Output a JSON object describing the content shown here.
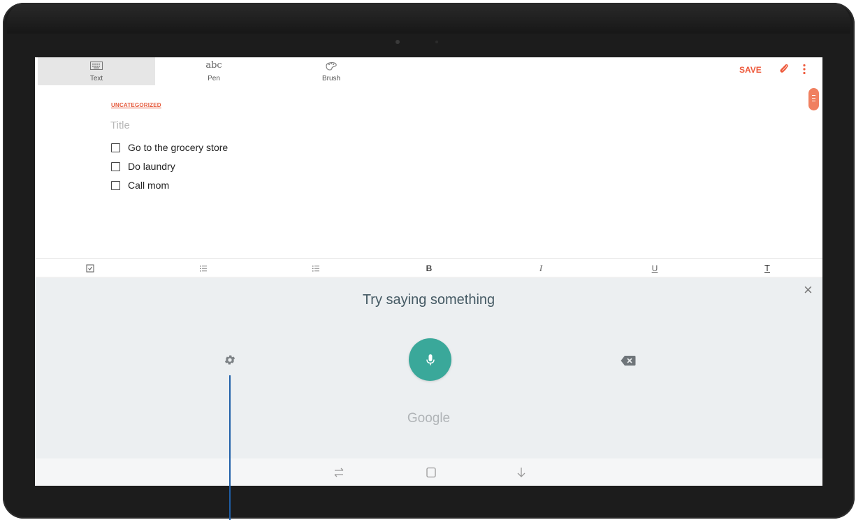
{
  "toolbar": {
    "modes": [
      {
        "label": "Text",
        "glyph": "",
        "icon": "keyboard-icon",
        "active": true
      },
      {
        "label": "Pen",
        "glyph": "abc",
        "icon": "pen-icon",
        "active": false
      },
      {
        "label": "Brush",
        "glyph": "",
        "icon": "brush-icon",
        "active": false
      }
    ],
    "save_label": "SAVE",
    "accent_color": "#ee5a3c"
  },
  "note": {
    "category": "UNCATEGORIZED",
    "title_placeholder": "Title",
    "checklist": [
      {
        "text": "Go to the grocery store",
        "checked": false
      },
      {
        "text": "Do laundry",
        "checked": false
      },
      {
        "text": "Call mom",
        "checked": false
      }
    ]
  },
  "format_bar": {
    "bold": "B",
    "italic": "I",
    "underline": "U",
    "text_style": "T"
  },
  "voice": {
    "prompt": "Try saying something",
    "brand": "Google",
    "mic_color": "#3aa89a"
  }
}
